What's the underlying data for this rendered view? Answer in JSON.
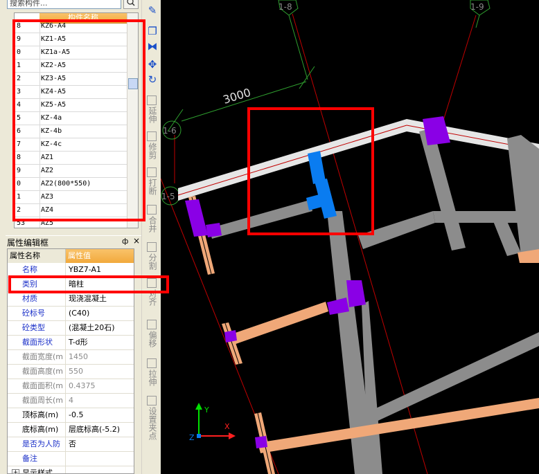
{
  "search": {
    "text": "搜索构件..."
  },
  "component_list": {
    "column_header": "构件名称",
    "rows": [
      {
        "num": "8",
        "name": "KZ6-A4"
      },
      {
        "num": "9",
        "name": "KZ1-A5"
      },
      {
        "num": "0",
        "name": "KZ1a-A5"
      },
      {
        "num": "1",
        "name": "KZ2-A5"
      },
      {
        "num": "2",
        "name": "KZ3-A5"
      },
      {
        "num": "3",
        "name": "KZ4-A5"
      },
      {
        "num": "4",
        "name": "KZ5-A5"
      },
      {
        "num": "5",
        "name": "KZ-4a"
      },
      {
        "num": "6",
        "name": "KZ-4b"
      },
      {
        "num": "7",
        "name": "KZ-4c"
      },
      {
        "num": "8",
        "name": "AZ1"
      },
      {
        "num": "9",
        "name": "AZ2"
      },
      {
        "num": "0",
        "name": "AZ2(800*550)"
      },
      {
        "num": "1",
        "name": "AZ3"
      },
      {
        "num": "2",
        "name": "AZ4"
      },
      {
        "num": "53",
        "name": "AZ5"
      }
    ]
  },
  "property_editor": {
    "title": "属性编辑框",
    "pin": "ф",
    "close": "×",
    "header_name": "属性名称",
    "header_value": "属性值",
    "expand_symbol": "+",
    "rows": [
      {
        "name": "名称",
        "value": "YBZ7-A1"
      },
      {
        "name": "类别",
        "value": "暗柱"
      },
      {
        "name": "材质",
        "value": "现浇混凝土"
      },
      {
        "name": "砼标号",
        "value": "(C40)"
      },
      {
        "name": "砼类型",
        "value": "(混凝土20石)"
      },
      {
        "name": "截面形状",
        "value": "T-d形"
      },
      {
        "name": "截面宽度(m",
        "value": "1450"
      },
      {
        "name": "截面高度(m",
        "value": "550"
      },
      {
        "name": "截面面积(m",
        "value": "0.4375"
      },
      {
        "name": "截面周长(m",
        "value": "4"
      },
      {
        "name": "顶标高(m)",
        "value": "-0.5"
      },
      {
        "name": "底标高(m)",
        "value": "层底标高(-5.2)"
      },
      {
        "name": "是否为人防",
        "value": "否"
      },
      {
        "name": "备注",
        "value": ""
      },
      {
        "name": "显示样式",
        "value": ""
      }
    ]
  },
  "toolbar": {
    "tools": [
      {
        "icon": "brush-icon",
        "glyph": "✎"
      },
      {
        "icon": "copy-icon",
        "glyph": "❐"
      },
      {
        "icon": "mirror-icon",
        "glyph": "⧓"
      },
      {
        "icon": "move-icon",
        "glyph": "✥"
      },
      {
        "icon": "rotate-icon",
        "glyph": "↻"
      }
    ],
    "commands": [
      {
        "label": "延伸"
      },
      {
        "label": "修剪"
      },
      {
        "label": "打断"
      },
      {
        "label": "合并"
      },
      {
        "label": "分割"
      },
      {
        "label": "对齐"
      },
      {
        "label": "偏移"
      },
      {
        "label": "拉伸"
      },
      {
        "label": "设置夹点"
      }
    ]
  },
  "canvas": {
    "grid_labels": [
      "1-8",
      "1-9",
      "1-6",
      "1-5"
    ],
    "dimension_text": "3000",
    "axis_labels": {
      "x": "X",
      "y": "Y",
      "z": "Z"
    },
    "colors": {
      "background": "#000000",
      "wall_gray": "#8c8c8c",
      "beam_white": "#e6e6e6",
      "beam_orange": "#f0a878",
      "column_purple": "#8a00e6",
      "selected_blue": "#0a7cf0",
      "grid_line_red": "#c00000",
      "dimension_green": "#2fa02f",
      "highlight_red": "#ff0000"
    }
  }
}
